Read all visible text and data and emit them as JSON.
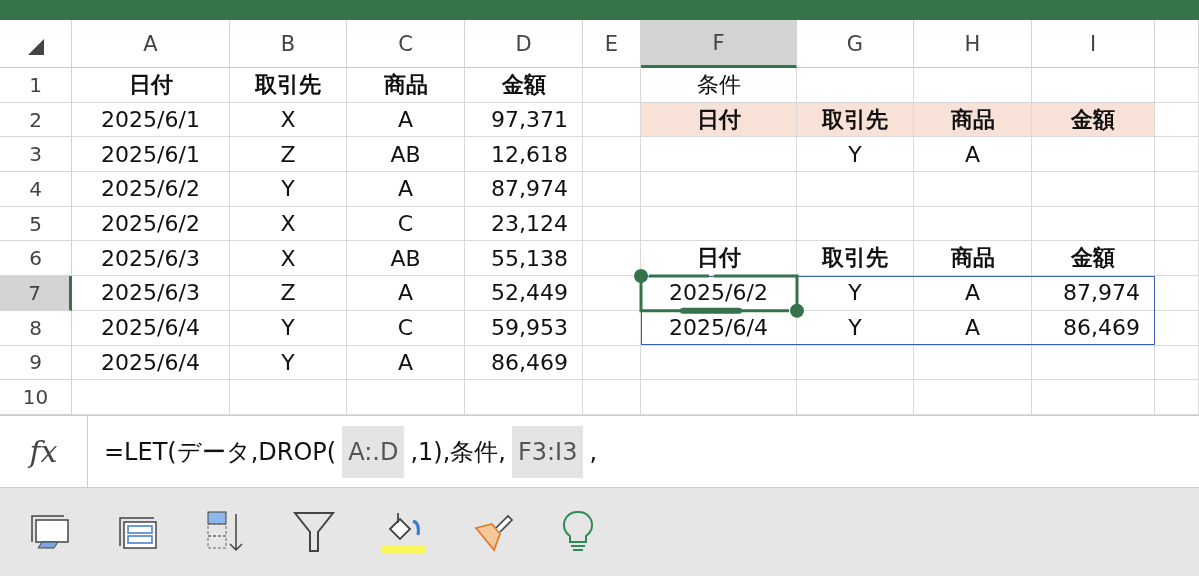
{
  "columns": [
    {
      "label": "A",
      "selected": false
    },
    {
      "label": "B",
      "selected": false
    },
    {
      "label": "C",
      "selected": false
    },
    {
      "label": "D",
      "selected": false
    },
    {
      "label": "E",
      "selected": false
    },
    {
      "label": "F",
      "selected": true
    },
    {
      "label": "G",
      "selected": false
    },
    {
      "label": "H",
      "selected": false
    },
    {
      "label": "I",
      "selected": false
    }
  ],
  "rows": [
    {
      "number": "1",
      "selected": false,
      "cells": {
        "A": {
          "text": "日付",
          "kind": "header"
        },
        "B": {
          "text": "取引先",
          "kind": "header"
        },
        "C": {
          "text": "商品",
          "kind": "header"
        },
        "D": {
          "text": "金額",
          "kind": "header"
        },
        "F": {
          "text": "条件",
          "kind": "text"
        }
      }
    },
    {
      "number": "2",
      "selected": false,
      "cells": {
        "A": {
          "text": "2025/6/1",
          "kind": "text"
        },
        "B": {
          "text": "X",
          "kind": "text"
        },
        "C": {
          "text": "A",
          "kind": "text"
        },
        "D": {
          "text": "97,371",
          "kind": "number"
        },
        "F": {
          "text": "日付",
          "kind": "criteria_header"
        },
        "G": {
          "text": "取引先",
          "kind": "criteria_header"
        },
        "H": {
          "text": "商品",
          "kind": "criteria_header"
        },
        "I": {
          "text": "金額",
          "kind": "criteria_header"
        }
      }
    },
    {
      "number": "3",
      "selected": false,
      "cells": {
        "A": {
          "text": "2025/6/1",
          "kind": "text"
        },
        "B": {
          "text": "Z",
          "kind": "text"
        },
        "C": {
          "text": "AB",
          "kind": "text"
        },
        "D": {
          "text": "12,618",
          "kind": "number"
        },
        "G": {
          "text": "Y",
          "kind": "text"
        },
        "H": {
          "text": "A",
          "kind": "text"
        }
      }
    },
    {
      "number": "4",
      "selected": false,
      "cells": {
        "A": {
          "text": "2025/6/2",
          "kind": "text"
        },
        "B": {
          "text": "Y",
          "kind": "text"
        },
        "C": {
          "text": "A",
          "kind": "text"
        },
        "D": {
          "text": "87,974",
          "kind": "number"
        }
      }
    },
    {
      "number": "5",
      "selected": false,
      "cells": {
        "A": {
          "text": "2025/6/2",
          "kind": "text"
        },
        "B": {
          "text": "X",
          "kind": "text"
        },
        "C": {
          "text": "C",
          "kind": "text"
        },
        "D": {
          "text": "23,124",
          "kind": "number"
        }
      }
    },
    {
      "number": "6",
      "selected": false,
      "cells": {
        "A": {
          "text": "2025/6/3",
          "kind": "text"
        },
        "B": {
          "text": "X",
          "kind": "text"
        },
        "C": {
          "text": "AB",
          "kind": "text"
        },
        "D": {
          "text": "55,138",
          "kind": "number"
        },
        "F": {
          "text": "日付",
          "kind": "header"
        },
        "G": {
          "text": "取引先",
          "kind": "header"
        },
        "H": {
          "text": "商品",
          "kind": "header"
        },
        "I": {
          "text": "金額",
          "kind": "header"
        }
      }
    },
    {
      "number": "7",
      "selected": true,
      "cells": {
        "A": {
          "text": "2025/6/3",
          "kind": "text"
        },
        "B": {
          "text": "Z",
          "kind": "text"
        },
        "C": {
          "text": "A",
          "kind": "text"
        },
        "D": {
          "text": "52,449",
          "kind": "number"
        },
        "F": {
          "text": "2025/6/2",
          "kind": "text"
        },
        "G": {
          "text": "Y",
          "kind": "text"
        },
        "H": {
          "text": "A",
          "kind": "text"
        },
        "I": {
          "text": "87,974",
          "kind": "number"
        }
      }
    },
    {
      "number": "8",
      "selected": false,
      "cells": {
        "A": {
          "text": "2025/6/4",
          "kind": "text"
        },
        "B": {
          "text": "Y",
          "kind": "text"
        },
        "C": {
          "text": "C",
          "kind": "text"
        },
        "D": {
          "text": "59,953",
          "kind": "number"
        },
        "F": {
          "text": "2025/6/4",
          "kind": "text"
        },
        "G": {
          "text": "Y",
          "kind": "text"
        },
        "H": {
          "text": "A",
          "kind": "text"
        },
        "I": {
          "text": "86,469",
          "kind": "number"
        }
      }
    },
    {
      "number": "9",
      "selected": false,
      "cells": {
        "A": {
          "text": "2025/6/4",
          "kind": "text"
        },
        "B": {
          "text": "Y",
          "kind": "text"
        },
        "C": {
          "text": "A",
          "kind": "text"
        },
        "D": {
          "text": "86,469",
          "kind": "number"
        }
      }
    },
    {
      "number": "10",
      "selected": false,
      "cells": {}
    }
  ],
  "formula": {
    "icon": "fx",
    "parts": [
      {
        "text": "=LET(データ,DROP(",
        "kind": "text"
      },
      {
        "text": "A:.D",
        "kind": "ref"
      },
      {
        "text": ",1),条件,",
        "kind": "text"
      },
      {
        "text": "F3:I3",
        "kind": "ref"
      },
      {
        "text": ",",
        "kind": "text"
      }
    ]
  }
}
